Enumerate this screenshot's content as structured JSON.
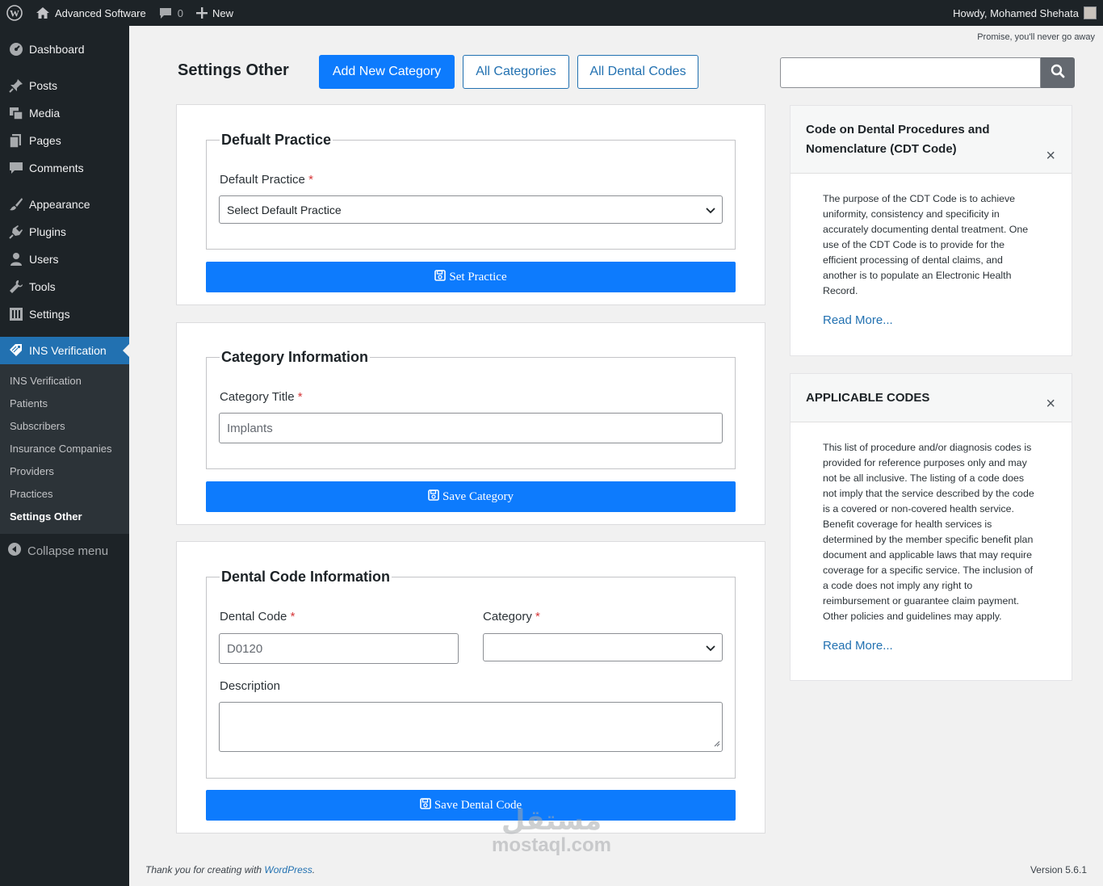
{
  "adminbar": {
    "site_name": "Advanced Software",
    "comments_count": "0",
    "new_label": "New",
    "howdy": "Howdy, Mohamed Shehata"
  },
  "sidebar": {
    "items": [
      {
        "label": "Dashboard",
        "icon": "dashboard-icon"
      },
      {
        "label": "Posts",
        "icon": "pin-icon"
      },
      {
        "label": "Media",
        "icon": "media-icon"
      },
      {
        "label": "Pages",
        "icon": "pages-icon"
      },
      {
        "label": "Comments",
        "icon": "comment-icon"
      },
      {
        "label": "Appearance",
        "icon": "brush-icon"
      },
      {
        "label": "Plugins",
        "icon": "plugin-icon"
      },
      {
        "label": "Users",
        "icon": "user-icon"
      },
      {
        "label": "Tools",
        "icon": "wrench-icon"
      },
      {
        "label": "Settings",
        "icon": "settings-icon"
      },
      {
        "label": "INS Verification",
        "icon": "tag-icon"
      }
    ],
    "submenu": [
      "INS Verification",
      "Patients",
      "Subscribers",
      "Insurance Companies",
      "Providers",
      "Practices",
      "Settings Other"
    ],
    "collapse_label": "Collapse menu"
  },
  "top_note": "Promise, you'll never go away",
  "header": {
    "title": "Settings Other",
    "add_new_category": "Add New Category",
    "all_categories": "All Categories",
    "all_dental_codes": "All Dental Codes"
  },
  "search": {
    "value": ""
  },
  "practice_card": {
    "legend": "Defualt Practice",
    "label": "Default Practice",
    "required_mark": "*",
    "select_value": "Select Default Practice",
    "button": "Set Practice"
  },
  "category_card": {
    "legend": "Category Information",
    "label": "Category Title",
    "required_mark": "*",
    "placeholder": "Implants",
    "button": "Save Category"
  },
  "dental_card": {
    "legend": "Dental Code Information",
    "code_label": "Dental Code",
    "code_placeholder": "D0120",
    "category_label": "Category",
    "required_mark": "*",
    "description_label": "Description",
    "button": "Save Dental Code"
  },
  "panels": [
    {
      "title": "Code on Dental Procedures and Nomenclature (CDT Code)",
      "close": "×",
      "body": "The purpose of the CDT Code is to achieve uniformity, consistency and specificity in accurately documenting dental treatment. One use of the CDT Code is to provide for the efficient processing of dental claims, and another is to populate an Electronic Health Record.",
      "read_more": "Read More..."
    },
    {
      "title": "APPLICABLE CODES",
      "close": "×",
      "body": "This list of procedure and/or diagnosis codes is provided for reference purposes only and may not be all inclusive. The listing of a code does not imply that the service described by the code is a covered or non-covered health service. Benefit coverage for health services is determined by the member specific benefit plan document and applicable laws that may require coverage for a specific service. The inclusion of a code does not imply any right to reimbursement or guarantee claim payment. Other policies and guidelines may apply.",
      "read_more": "Read More..."
    }
  ],
  "footer": {
    "thanks": "Thank you for creating with",
    "wp_link": "WordPress",
    "period": ".",
    "version": "Version 5.6.1"
  },
  "watermark": {
    "arabic": "مستقل",
    "latin": "mostaql.com"
  },
  "colors": {
    "primary": "#0d7bfd",
    "sidebar": "#1d2327",
    "active_menu": "#2271b1"
  }
}
